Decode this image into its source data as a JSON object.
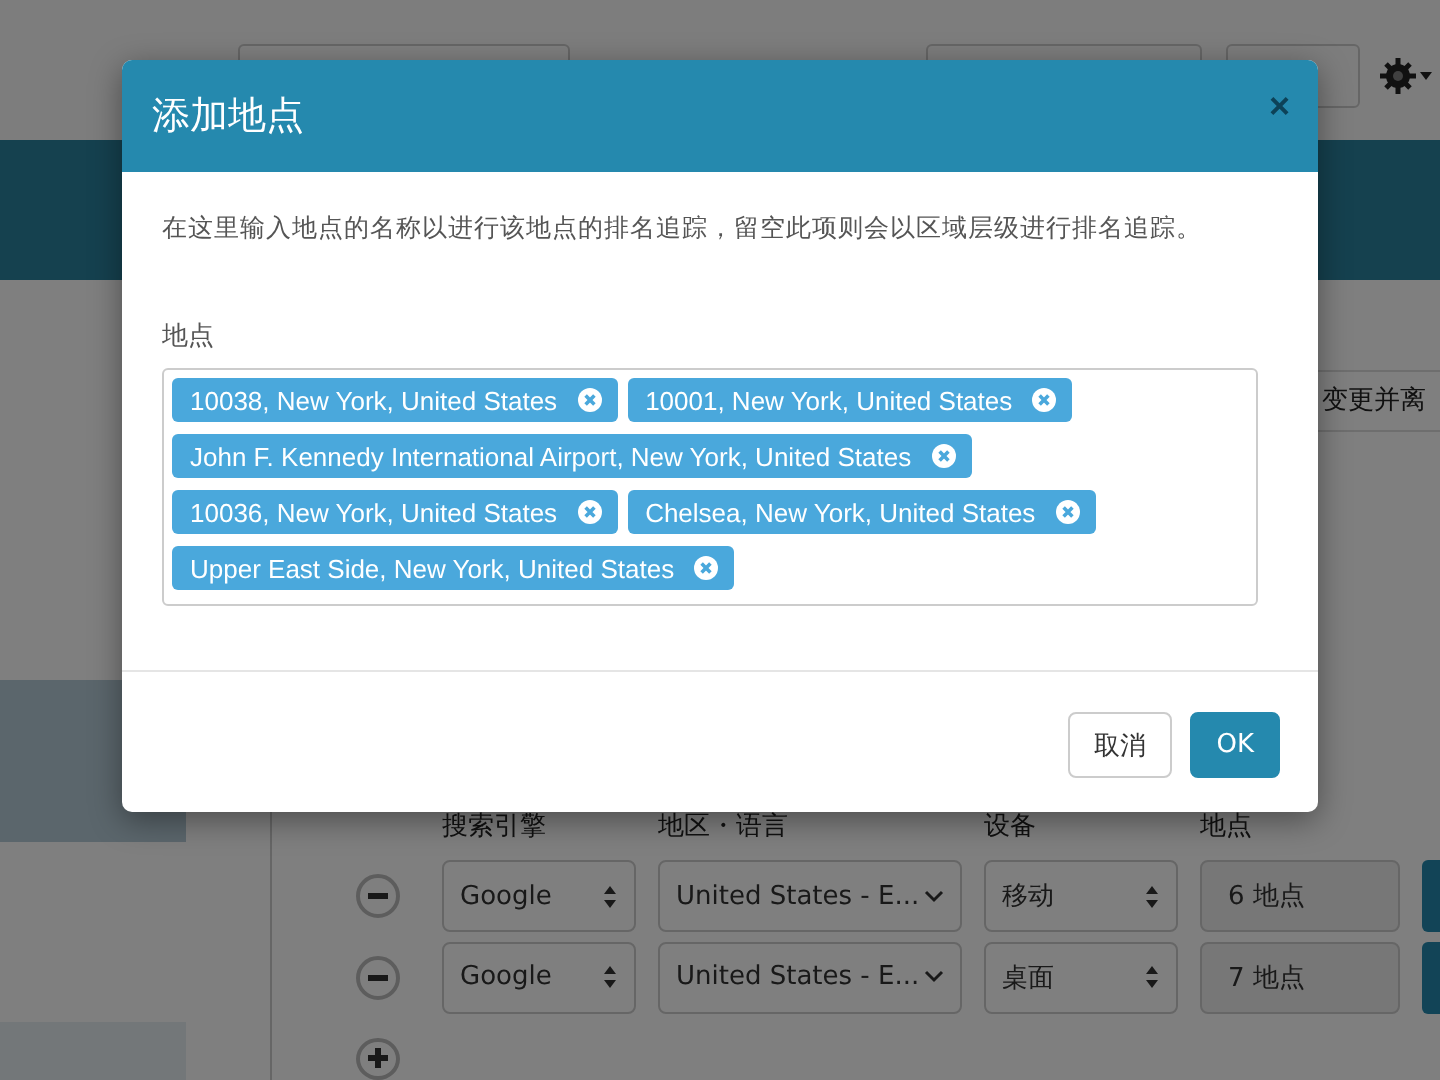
{
  "page": {
    "notice": "变更并离",
    "columns": [
      "搜索引擎",
      "地区・语言",
      "设备",
      "地点"
    ],
    "rows": [
      {
        "engine": "Google",
        "region": "United States - E...",
        "device": "移动",
        "locations": "6 地点"
      },
      {
        "engine": "Google",
        "region": "United States - E...",
        "device": "桌面",
        "locations": "7 地点"
      }
    ]
  },
  "dialog": {
    "title": "添加地点",
    "close": "×",
    "description": "在这里输入地点的名称以进行该地点的排名追踪，留空此项则会以区域层级进行排名追踪。",
    "field_label": "地点",
    "tags": [
      "10038, New York, United States",
      "10001, New York, United States",
      "John F. Kennedy International Airport, New York, United States",
      "10036, New York, United States",
      "Chelsea, New York, United States",
      "Upper East Side, New York, United States"
    ],
    "buttons": [
      {
        "label": "取消",
        "kind": "secondary"
      },
      {
        "label": "OK",
        "kind": "primary"
      }
    ]
  }
}
